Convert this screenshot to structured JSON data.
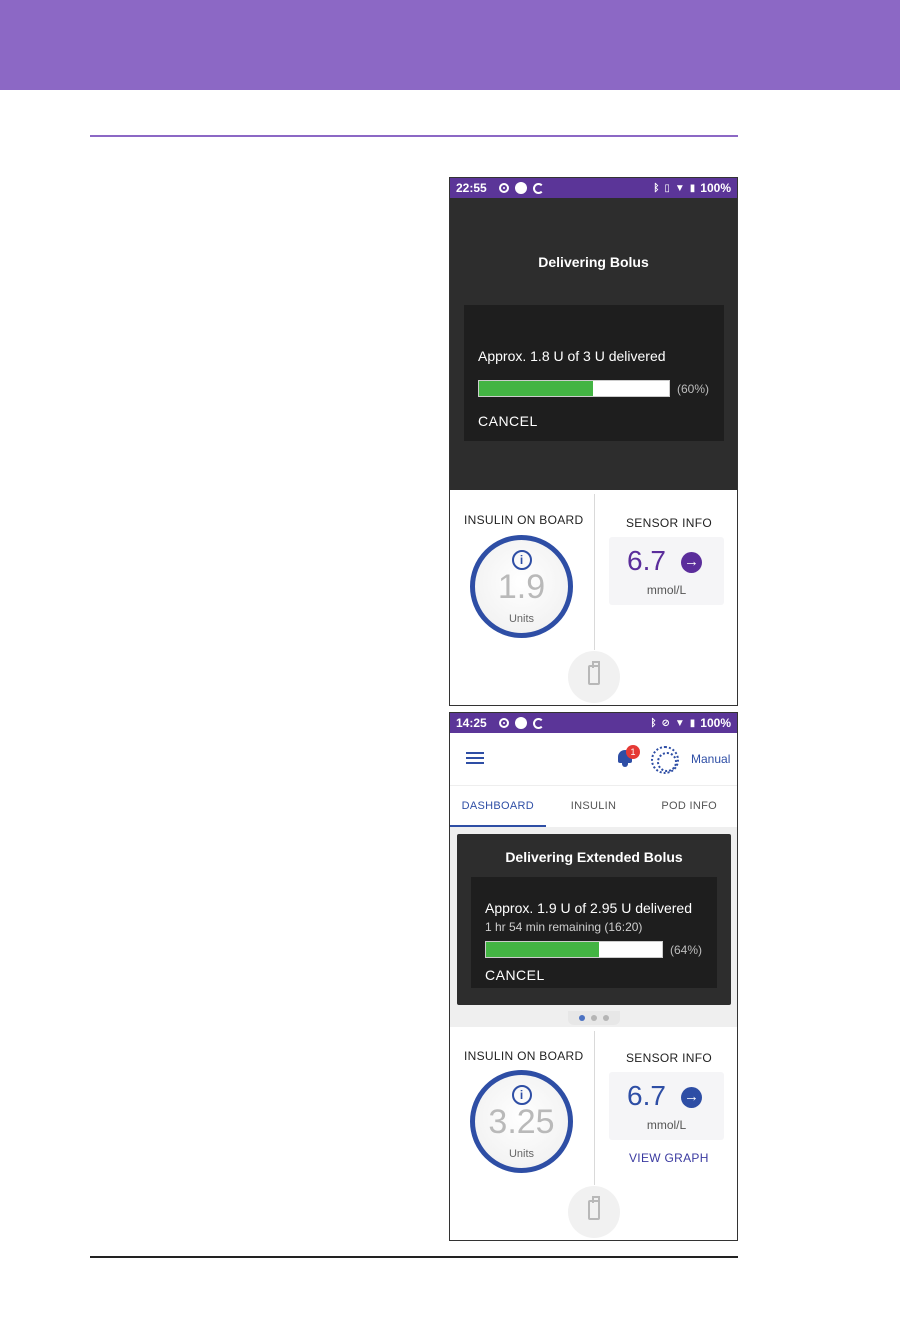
{
  "screen1": {
    "status": {
      "time": "22:55",
      "battery": "100%"
    },
    "title": "Delivering Bolus",
    "progress": {
      "text": "Approx. 1.8 U of 3 U delivered",
      "percent": 60,
      "percent_label": "(60%)",
      "cancel_label": "CANCEL"
    },
    "iob": {
      "label": "INSULIN ON BOARD",
      "value": "1.9",
      "units": "Units"
    },
    "sensor": {
      "label": "SENSOR INFO",
      "value": "6.7",
      "unit": "mmol/L",
      "color": "#5b2d9b"
    }
  },
  "screen2": {
    "status": {
      "time": "14:25",
      "battery": "100%"
    },
    "appbar": {
      "notification_count": "1",
      "mode_label": "Manual"
    },
    "tabs": [
      {
        "label": "DASHBOARD"
      },
      {
        "label": "INSULIN"
      },
      {
        "label": "POD INFO"
      }
    ],
    "title": "Delivering Extended Bolus",
    "progress": {
      "text": "Approx. 1.9 U of 2.95 U delivered",
      "remaining": "1 hr 54 min remaining (16:20)",
      "percent": 64,
      "percent_label": "(64%)",
      "cancel_label": "CANCEL"
    },
    "iob": {
      "label": "INSULIN ON BOARD",
      "value": "3.25",
      "units": "Units"
    },
    "sensor": {
      "label": "SENSOR INFO",
      "value": "6.7",
      "unit": "mmol/L",
      "view_graph": "VIEW GRAPH",
      "color": "#2e4ea5"
    }
  },
  "colors": {
    "header": "#8c68c5",
    "statusbar": "#5b3598",
    "progress_fill": "#43b443",
    "accent": "#2e4ea5"
  }
}
